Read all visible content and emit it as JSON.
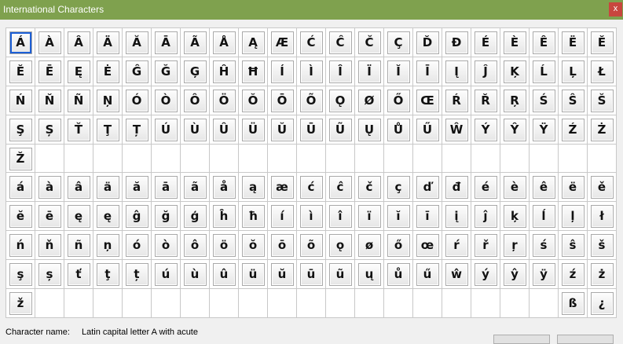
{
  "window": {
    "title": "International Characters",
    "close_label": "x"
  },
  "uppercase": [
    "Á",
    "À",
    "Â",
    "Ä",
    "Ă",
    "Ā",
    "Ã",
    "Å",
    "Ą",
    "Æ",
    "Ć",
    "Ĉ",
    "Č",
    "Ç",
    "Ď",
    "Đ",
    "É",
    "È",
    "Ê",
    "Ë",
    "Ě",
    "Ĕ",
    "Ē",
    "Ę",
    "Ė",
    "Ĝ",
    "Ğ",
    "Ģ",
    "Ĥ",
    "Ħ",
    "Í",
    "Ì",
    "Î",
    "Ï",
    "Ĭ",
    "Ī",
    "Į",
    "Ĵ",
    "Ķ",
    "Ĺ",
    "Ļ",
    "Ł",
    "Ń",
    "Ň",
    "Ñ",
    "Ņ",
    "Ó",
    "Ò",
    "Ô",
    "Ö",
    "Ŏ",
    "Ō",
    "Õ",
    "Ǫ",
    "Ø",
    "Ő",
    "Œ",
    "Ŕ",
    "Ř",
    "Ŗ",
    "Ś",
    "Ŝ",
    "Š",
    "Ş",
    "Ș",
    "Ť",
    "Ţ",
    "Ț",
    "Ú",
    "Ù",
    "Û",
    "Ü",
    "Ŭ",
    "Ū",
    "Ũ",
    "Ų",
    "Ů",
    "Ű",
    "Ŵ",
    "Ý",
    "Ŷ",
    "Ÿ",
    "Ź",
    "Ż",
    "Ž"
  ],
  "lowercase": [
    "á",
    "à",
    "â",
    "ä",
    "ă",
    "ā",
    "ã",
    "å",
    "ą",
    "æ",
    "ć",
    "ĉ",
    "č",
    "ç",
    "ď",
    "đ",
    "é",
    "è",
    "ê",
    "ë",
    "ě",
    "ĕ",
    "ē",
    "ę",
    "ę",
    "ĝ",
    "ğ",
    "ģ",
    "ĥ",
    "ħ",
    "í",
    "ì",
    "î",
    "ï",
    "ĭ",
    "ī",
    "į",
    "ĵ",
    "ķ",
    "ĺ",
    "ļ",
    "ł",
    "ń",
    "ň",
    "ñ",
    "ņ",
    "ó",
    "ò",
    "ô",
    "ö",
    "ŏ",
    "ō",
    "õ",
    "ǫ",
    "ø",
    "ő",
    "œ",
    "ŕ",
    "ř",
    "ŗ",
    "ś",
    "ŝ",
    "š",
    "ş",
    "ș",
    "ť",
    "ţ",
    "ț",
    "ú",
    "ù",
    "û",
    "ü",
    "ŭ",
    "ū",
    "ũ",
    "ų",
    "ů",
    "ű",
    "ŵ",
    "ý",
    "ŷ",
    "ÿ",
    "ź",
    "ż",
    "ž"
  ],
  "lowercase_extra": [
    "ß",
    "¿"
  ],
  "selected_index": 0,
  "status": {
    "label": "Character name:",
    "value": "Latin capital letter A with acute"
  }
}
